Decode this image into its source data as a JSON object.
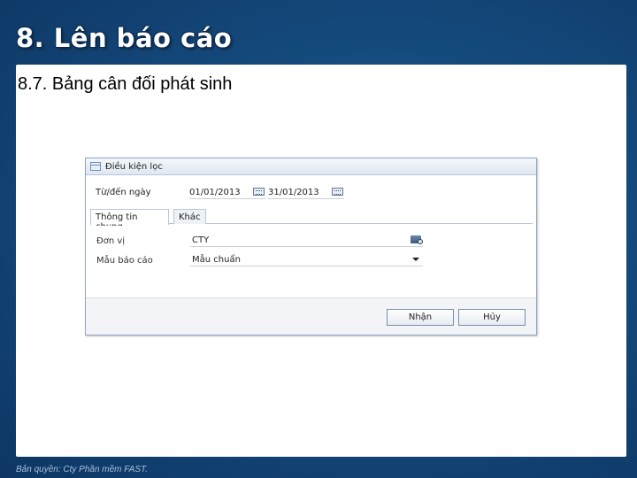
{
  "slide": {
    "title": "8. Lên báo cáo",
    "section_heading": "8.7. Bảng cân đối phát sinh",
    "footer": "Bản quyền: Cty Phần mềm FAST."
  },
  "dialog": {
    "title": "Điều kiện lọc",
    "date_label": "Từ/đến ngày",
    "date_from": "01/01/2013",
    "date_to": "31/01/2013",
    "tabs": [
      {
        "label": "Thông tin chung",
        "active": true
      },
      {
        "label": "Khác",
        "active": false
      }
    ],
    "fields": {
      "unit_label": "Đơn vị",
      "unit_value": "CTY",
      "template_label": "Mẫu báo cáo",
      "template_value": "Mẫu chuẩn"
    },
    "buttons": {
      "ok": "Nhận",
      "cancel": "Hủy"
    }
  },
  "colors": {
    "background": "#154a7d",
    "panel": "#ffffff",
    "title_text": "#ffffff",
    "footer_text": "#a9c0dc"
  },
  "icons": [
    "dialog-icon",
    "calendar-icon",
    "lookup-icon",
    "chevron-down-icon"
  ]
}
